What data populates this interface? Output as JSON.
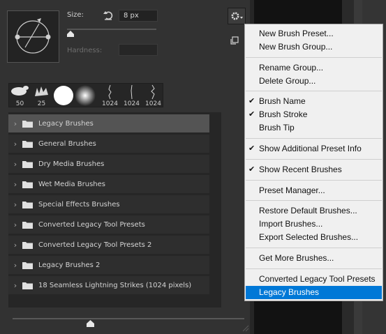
{
  "brush_settings": {
    "size_label": "Size:",
    "size_value": "8 px",
    "hardness_label": "Hardness:",
    "size_slider_fraction": 0.04
  },
  "recent_brushes": [
    {
      "size": "50"
    },
    {
      "size": "25"
    },
    {
      "size": ""
    },
    {
      "size": ""
    },
    {
      "size": "1024"
    },
    {
      "size": "1024"
    },
    {
      "size": "1024"
    }
  ],
  "brush_groups": [
    {
      "name": "Legacy Brushes",
      "selected": true
    },
    {
      "name": "General Brushes"
    },
    {
      "name": "Dry Media Brushes"
    },
    {
      "name": "Wet Media Brushes"
    },
    {
      "name": "Special Effects Brushes"
    },
    {
      "name": "Converted Legacy Tool Presets"
    },
    {
      "name": "Converted Legacy Tool Presets 2"
    },
    {
      "name": "Legacy Brushes 2"
    },
    {
      "name": "18 Seamless Lightning Strikes (1024 pixels)"
    }
  ],
  "menu": {
    "items": [
      {
        "label": "New Brush Preset...",
        "checked": false
      },
      {
        "label": "New Brush Group...",
        "checked": false
      },
      {
        "label": "Rename Group...",
        "checked": false
      },
      {
        "label": "Delete Group...",
        "checked": false
      },
      {
        "label": "Brush Name",
        "checked": true
      },
      {
        "label": "Brush Stroke",
        "checked": true
      },
      {
        "label": "Brush Tip",
        "checked": false
      },
      {
        "label": "Show Additional Preset Info",
        "checked": true
      },
      {
        "label": "Show Recent Brushes",
        "checked": true
      },
      {
        "label": "Preset Manager...",
        "checked": false
      },
      {
        "label": "Restore Default Brushes...",
        "checked": false
      },
      {
        "label": "Import Brushes...",
        "checked": false
      },
      {
        "label": "Export Selected Brushes...",
        "checked": false
      },
      {
        "label": "Get More Brushes...",
        "checked": false
      },
      {
        "label": "Converted Legacy Tool Presets",
        "checked": false
      },
      {
        "label": "Legacy Brushes",
        "checked": false,
        "highlighted": true
      }
    ],
    "check_glyph": "✔"
  },
  "icons": {
    "gear": "gear-icon",
    "reset": "reset-icon",
    "new_group": "new-group-icon",
    "folder": "folder-icon",
    "chevron": "chevron-right-icon"
  },
  "colors": {
    "panel": "#323232",
    "list_row": "#2e2e2e",
    "list_row_selected": "#545454",
    "menu_bg": "#f0f0f0",
    "menu_highlight": "#0078d7"
  }
}
